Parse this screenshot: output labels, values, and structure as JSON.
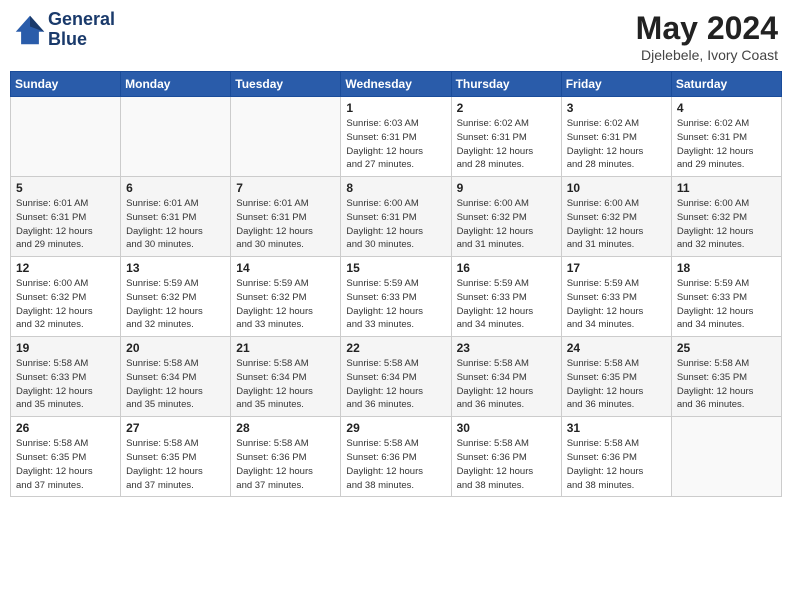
{
  "header": {
    "logo_line1": "General",
    "logo_line2": "Blue",
    "title": "May 2024",
    "subtitle": "Djelebele, Ivory Coast"
  },
  "days_of_week": [
    "Sunday",
    "Monday",
    "Tuesday",
    "Wednesday",
    "Thursday",
    "Friday",
    "Saturday"
  ],
  "weeks": [
    [
      {
        "num": "",
        "info": ""
      },
      {
        "num": "",
        "info": ""
      },
      {
        "num": "",
        "info": ""
      },
      {
        "num": "1",
        "info": "Sunrise: 6:03 AM\nSunset: 6:31 PM\nDaylight: 12 hours\nand 27 minutes."
      },
      {
        "num": "2",
        "info": "Sunrise: 6:02 AM\nSunset: 6:31 PM\nDaylight: 12 hours\nand 28 minutes."
      },
      {
        "num": "3",
        "info": "Sunrise: 6:02 AM\nSunset: 6:31 PM\nDaylight: 12 hours\nand 28 minutes."
      },
      {
        "num": "4",
        "info": "Sunrise: 6:02 AM\nSunset: 6:31 PM\nDaylight: 12 hours\nand 29 minutes."
      }
    ],
    [
      {
        "num": "5",
        "info": "Sunrise: 6:01 AM\nSunset: 6:31 PM\nDaylight: 12 hours\nand 29 minutes."
      },
      {
        "num": "6",
        "info": "Sunrise: 6:01 AM\nSunset: 6:31 PM\nDaylight: 12 hours\nand 30 minutes."
      },
      {
        "num": "7",
        "info": "Sunrise: 6:01 AM\nSunset: 6:31 PM\nDaylight: 12 hours\nand 30 minutes."
      },
      {
        "num": "8",
        "info": "Sunrise: 6:00 AM\nSunset: 6:31 PM\nDaylight: 12 hours\nand 30 minutes."
      },
      {
        "num": "9",
        "info": "Sunrise: 6:00 AM\nSunset: 6:32 PM\nDaylight: 12 hours\nand 31 minutes."
      },
      {
        "num": "10",
        "info": "Sunrise: 6:00 AM\nSunset: 6:32 PM\nDaylight: 12 hours\nand 31 minutes."
      },
      {
        "num": "11",
        "info": "Sunrise: 6:00 AM\nSunset: 6:32 PM\nDaylight: 12 hours\nand 32 minutes."
      }
    ],
    [
      {
        "num": "12",
        "info": "Sunrise: 6:00 AM\nSunset: 6:32 PM\nDaylight: 12 hours\nand 32 minutes."
      },
      {
        "num": "13",
        "info": "Sunrise: 5:59 AM\nSunset: 6:32 PM\nDaylight: 12 hours\nand 32 minutes."
      },
      {
        "num": "14",
        "info": "Sunrise: 5:59 AM\nSunset: 6:32 PM\nDaylight: 12 hours\nand 33 minutes."
      },
      {
        "num": "15",
        "info": "Sunrise: 5:59 AM\nSunset: 6:33 PM\nDaylight: 12 hours\nand 33 minutes."
      },
      {
        "num": "16",
        "info": "Sunrise: 5:59 AM\nSunset: 6:33 PM\nDaylight: 12 hours\nand 34 minutes."
      },
      {
        "num": "17",
        "info": "Sunrise: 5:59 AM\nSunset: 6:33 PM\nDaylight: 12 hours\nand 34 minutes."
      },
      {
        "num": "18",
        "info": "Sunrise: 5:59 AM\nSunset: 6:33 PM\nDaylight: 12 hours\nand 34 minutes."
      }
    ],
    [
      {
        "num": "19",
        "info": "Sunrise: 5:58 AM\nSunset: 6:33 PM\nDaylight: 12 hours\nand 35 minutes."
      },
      {
        "num": "20",
        "info": "Sunrise: 5:58 AM\nSunset: 6:34 PM\nDaylight: 12 hours\nand 35 minutes."
      },
      {
        "num": "21",
        "info": "Sunrise: 5:58 AM\nSunset: 6:34 PM\nDaylight: 12 hours\nand 35 minutes."
      },
      {
        "num": "22",
        "info": "Sunrise: 5:58 AM\nSunset: 6:34 PM\nDaylight: 12 hours\nand 36 minutes."
      },
      {
        "num": "23",
        "info": "Sunrise: 5:58 AM\nSunset: 6:34 PM\nDaylight: 12 hours\nand 36 minutes."
      },
      {
        "num": "24",
        "info": "Sunrise: 5:58 AM\nSunset: 6:35 PM\nDaylight: 12 hours\nand 36 minutes."
      },
      {
        "num": "25",
        "info": "Sunrise: 5:58 AM\nSunset: 6:35 PM\nDaylight: 12 hours\nand 36 minutes."
      }
    ],
    [
      {
        "num": "26",
        "info": "Sunrise: 5:58 AM\nSunset: 6:35 PM\nDaylight: 12 hours\nand 37 minutes."
      },
      {
        "num": "27",
        "info": "Sunrise: 5:58 AM\nSunset: 6:35 PM\nDaylight: 12 hours\nand 37 minutes."
      },
      {
        "num": "28",
        "info": "Sunrise: 5:58 AM\nSunset: 6:36 PM\nDaylight: 12 hours\nand 37 minutes."
      },
      {
        "num": "29",
        "info": "Sunrise: 5:58 AM\nSunset: 6:36 PM\nDaylight: 12 hours\nand 38 minutes."
      },
      {
        "num": "30",
        "info": "Sunrise: 5:58 AM\nSunset: 6:36 PM\nDaylight: 12 hours\nand 38 minutes."
      },
      {
        "num": "31",
        "info": "Sunrise: 5:58 AM\nSunset: 6:36 PM\nDaylight: 12 hours\nand 38 minutes."
      },
      {
        "num": "",
        "info": ""
      }
    ]
  ]
}
